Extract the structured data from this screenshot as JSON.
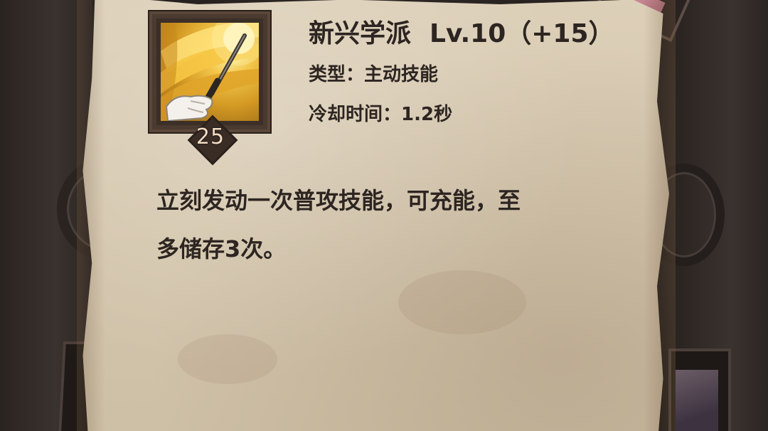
{
  "skill": {
    "name": "新兴学派",
    "level_text": "Lv.10（+15）",
    "type_label": "类型：",
    "type_value": "主动技能",
    "cooldown_label": "冷却时间：",
    "cooldown_value": "1.2秒",
    "badge_number": "25",
    "icon": "golden-scalpel-slash-icon",
    "description_line1": "立刻发动一次普攻技能，可充能，至",
    "description_line2": "多储存3次。"
  },
  "colors": {
    "parchment": "#d5c7ae",
    "text": "#2d2521",
    "badge_text": "#f3dcc4",
    "icon_glow": "#f2c64a"
  }
}
